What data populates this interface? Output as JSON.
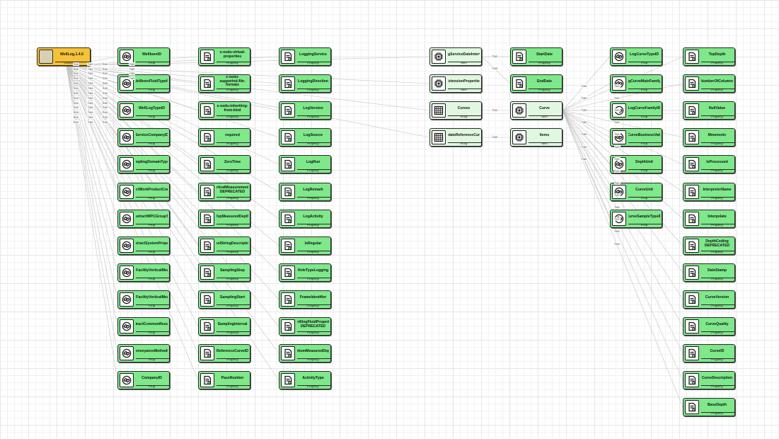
{
  "edge_label": "has",
  "root": {
    "id": "root",
    "title": "WellLog.1.4.0",
    "type": "OSDUType",
    "icon": "schema-box-icon"
  },
  "columns": [
    {
      "name": "abstract-and-id",
      "nodes": [
        {
          "id": "c1_0",
          "title": "WellboreID",
          "type": "Prop",
          "icon": "link-icon",
          "kind": "abstract"
        },
        {
          "id": "c1_1",
          "title": "WellboreFluidTypeID",
          "type": "Prop",
          "icon": "link-icon",
          "kind": "abstract"
        },
        {
          "id": "c1_2",
          "title": "WellLogTypeID",
          "type": "Prop",
          "icon": "link-icon",
          "kind": "abstract"
        },
        {
          "id": "c1_3",
          "title": "ServiceCompanyID",
          "type": "Prop",
          "icon": "link-icon",
          "kind": "abstract"
        },
        {
          "id": "c1_4",
          "title": "SamplingDomainTypeID",
          "type": "Prop",
          "icon": "link-icon",
          "kind": "abstract"
        },
        {
          "id": "c1_5",
          "title": "IsAbstractWorkProductComponent",
          "type": "Prop",
          "icon": "link-icon",
          "kind": "abstract"
        },
        {
          "id": "c1_6",
          "title": "IsAbstractWPCGroupType",
          "type": "Prop",
          "icon": "link-icon",
          "kind": "abstract"
        },
        {
          "id": "c1_7",
          "title": "IsAbstractSystemProperties",
          "type": "Prop",
          "icon": "link-icon",
          "kind": "abstract"
        },
        {
          "id": "c1_8",
          "title": "IsAbstractFacilityVerticalMeasurement",
          "type": "Prop",
          "icon": "link-icon",
          "kind": "abstract"
        },
        {
          "id": "c1_9",
          "title": "IsAbstractFacilityVerticalMeasurement",
          "type": "Prop",
          "icon": "link-icon",
          "kind": "abstract"
        },
        {
          "id": "c1_10",
          "title": "IsAbstractCommonResources",
          "type": "Prop",
          "icon": "link-icon",
          "kind": "abstract"
        },
        {
          "id": "c1_11",
          "title": "ConveyanceMethodID",
          "type": "Prop",
          "icon": "link-icon",
          "kind": "abstract"
        },
        {
          "id": "c1_12",
          "title": "CompanyID",
          "type": "Prop",
          "icon": "link-icon",
          "kind": "abstract"
        }
      ]
    },
    {
      "name": "properties-a",
      "nodes": [
        {
          "id": "c2_0",
          "title": "x-osdu-virtual-properties",
          "type": "Property",
          "icon": "document-icon",
          "kind": "property"
        },
        {
          "id": "c2_1",
          "title": "x-osdu-supported-file-formats",
          "type": "Property",
          "icon": "document-icon",
          "kind": "property"
        },
        {
          "id": "c2_2",
          "title": "x-osdu-inheriting-from-kind",
          "type": "Property",
          "icon": "document-icon",
          "kind": "property"
        },
        {
          "id": "c2_3",
          "title": "required",
          "type": "Property",
          "icon": "document-icon",
          "kind": "property"
        },
        {
          "id": "c2_4",
          "title": "ZeroTime",
          "type": "Property",
          "icon": "document-icon",
          "kind": "property"
        },
        {
          "id": "c2_5",
          "title": "VerticalMeasurementID DEPRECATED",
          "type": "Property",
          "icon": "document-icon",
          "kind": "property"
        },
        {
          "id": "c2_6",
          "title": "TopMeasuredDepth",
          "type": "Property",
          "icon": "document-icon",
          "kind": "property"
        },
        {
          "id": "c2_7",
          "title": "ToolStringDescription",
          "type": "Property",
          "icon": "document-icon",
          "kind": "property"
        },
        {
          "id": "c2_8",
          "title": "SamplingStop",
          "type": "Property",
          "icon": "document-icon",
          "kind": "property"
        },
        {
          "id": "c2_9",
          "title": "SamplingStart",
          "type": "Property",
          "icon": "document-icon",
          "kind": "property"
        },
        {
          "id": "c2_10",
          "title": "SamplingInterval",
          "type": "Property",
          "icon": "document-icon",
          "kind": "property"
        },
        {
          "id": "c2_11",
          "title": "ReferenceCurveID",
          "type": "Property",
          "icon": "document-icon",
          "kind": "property"
        },
        {
          "id": "c2_12",
          "title": "PassNumber",
          "type": "Property",
          "icon": "document-icon",
          "kind": "property"
        }
      ]
    },
    {
      "name": "properties-b",
      "nodes": [
        {
          "id": "c3_0",
          "title": "LoggingService",
          "type": "Property",
          "icon": "document-icon",
          "kind": "property"
        },
        {
          "id": "c3_1",
          "title": "LoggingDirection",
          "type": "Property",
          "icon": "document-icon",
          "kind": "property"
        },
        {
          "id": "c3_2",
          "title": "LogVersion",
          "type": "Property",
          "icon": "document-icon",
          "kind": "property"
        },
        {
          "id": "c3_3",
          "title": "LogSource",
          "type": "Property",
          "icon": "document-icon",
          "kind": "property"
        },
        {
          "id": "c3_4",
          "title": "LogRun",
          "type": "Property",
          "icon": "document-icon",
          "kind": "property"
        },
        {
          "id": "c3_5",
          "title": "LogRemark",
          "type": "Property",
          "icon": "document-icon",
          "kind": "property"
        },
        {
          "id": "c3_6",
          "title": "LogActivity",
          "type": "Property",
          "icon": "document-icon",
          "kind": "property"
        },
        {
          "id": "c3_7",
          "title": "IsRegular",
          "type": "Property",
          "icon": "document-icon",
          "kind": "property"
        },
        {
          "id": "c3_8",
          "title": "HoleTypeLogging",
          "type": "Property",
          "icon": "document-icon",
          "kind": "property"
        },
        {
          "id": "c3_9",
          "title": "FrameIdentifier",
          "type": "Property",
          "icon": "document-icon",
          "kind": "property"
        },
        {
          "id": "c3_10",
          "title": "DrillingFluidProperty DEPRECATED",
          "type": "Property",
          "icon": "document-icon",
          "kind": "property"
        },
        {
          "id": "c3_11",
          "title": "BottomMeasuredDepth",
          "type": "Property",
          "icon": "document-icon",
          "kind": "property"
        },
        {
          "id": "c3_12",
          "title": "ActivityType",
          "type": "Property",
          "icon": "document-icon",
          "kind": "property"
        }
      ]
    },
    {
      "name": "arrays-items",
      "nodes": [
        {
          "id": "c4_0",
          "title": "LogServiceDateInterval",
          "type": "Item",
          "icon": "chip-icon",
          "kind": "item"
        },
        {
          "id": "c4_1",
          "title": "ExtensionProperties",
          "type": "Item",
          "icon": "chip-icon",
          "kind": "item"
        },
        {
          "id": "c4_2",
          "title": "Curves",
          "type": "Array",
          "icon": "grid-icon",
          "kind": "array"
        },
        {
          "id": "c4_3",
          "title": "CandidateReferenceCurveIDs",
          "type": "Array",
          "icon": "grid-icon",
          "kind": "array"
        }
      ]
    },
    {
      "name": "interval-and-items",
      "nodes": [
        {
          "id": "c5_0",
          "title": "StartDate",
          "type": "Property",
          "icon": "document-icon",
          "kind": "property"
        },
        {
          "id": "c5_1",
          "title": "EndDate",
          "type": "Property",
          "icon": "document-icon",
          "kind": "property"
        },
        {
          "id": "c5_2",
          "title": "Curve",
          "type": "Item",
          "icon": "chip-icon",
          "kind": "item"
        },
        {
          "id": "c5_3",
          "title": "Items",
          "type": "Item",
          "icon": "chip-icon",
          "kind": "item"
        }
      ]
    },
    {
      "name": "curve-ids",
      "nodes": [
        {
          "id": "c6_0",
          "title": "LogCurveTypeID",
          "type": "Prop",
          "icon": "link-icon",
          "kind": "abstract"
        },
        {
          "id": "c6_1",
          "title": "LogCurveMainFamilyID",
          "type": "Prop",
          "icon": "link-icon",
          "kind": "abstract"
        },
        {
          "id": "c6_2",
          "title": "LogCurveFamilyID",
          "type": "Prop",
          "icon": "link-icon",
          "kind": "abstract"
        },
        {
          "id": "c6_3",
          "title": "LogCurveBusinessValueID",
          "type": "Prop",
          "icon": "link-icon",
          "kind": "abstract"
        },
        {
          "id": "c6_4",
          "title": "DepthUnit",
          "type": "Prop",
          "icon": "link-icon",
          "kind": "abstract"
        },
        {
          "id": "c6_5",
          "title": "CurveUnit",
          "type": "Prop",
          "icon": "link-icon",
          "kind": "abstract"
        },
        {
          "id": "c6_6",
          "title": "CurveSampleTypeID",
          "type": "Prop",
          "icon": "link-icon",
          "kind": "abstract"
        }
      ]
    },
    {
      "name": "curve-properties",
      "nodes": [
        {
          "id": "c7_0",
          "title": "TopDepth",
          "type": "Property",
          "icon": "document-icon",
          "kind": "property"
        },
        {
          "id": "c7_1",
          "title": "NumberOfColumns",
          "type": "Property",
          "icon": "document-icon",
          "kind": "property"
        },
        {
          "id": "c7_2",
          "title": "NullValue",
          "type": "Property",
          "icon": "document-icon",
          "kind": "property"
        },
        {
          "id": "c7_3",
          "title": "Mnemonic",
          "type": "Property",
          "icon": "document-icon",
          "kind": "property"
        },
        {
          "id": "c7_4",
          "title": "IsProcessed",
          "type": "Property",
          "icon": "document-icon",
          "kind": "property"
        },
        {
          "id": "c7_5",
          "title": "InterpreterName",
          "type": "Property",
          "icon": "document-icon",
          "kind": "property"
        },
        {
          "id": "c7_6",
          "title": "Interpolate",
          "type": "Property",
          "icon": "document-icon",
          "kind": "property"
        },
        {
          "id": "c7_7",
          "title": "DepthCoding DEPRECATED",
          "type": "Property",
          "icon": "document-icon",
          "kind": "property"
        },
        {
          "id": "c7_8",
          "title": "DateStamp",
          "type": "Property",
          "icon": "document-icon",
          "kind": "property"
        },
        {
          "id": "c7_9",
          "title": "CurveVersion",
          "type": "Property",
          "icon": "document-icon",
          "kind": "property"
        },
        {
          "id": "c7_10",
          "title": "CurveQuality",
          "type": "Property",
          "icon": "document-icon",
          "kind": "property"
        },
        {
          "id": "c7_11",
          "title": "CurveID",
          "type": "Property",
          "icon": "document-icon",
          "kind": "property"
        },
        {
          "id": "c7_12",
          "title": "CurveDescription",
          "type": "Property",
          "icon": "document-icon",
          "kind": "property"
        },
        {
          "id": "c7_13",
          "title": "BaseDepth",
          "type": "Property",
          "icon": "document-icon",
          "kind": "property"
        }
      ]
    }
  ],
  "edges": [
    [
      "root",
      "c1_0"
    ],
    [
      "root",
      "c1_1"
    ],
    [
      "root",
      "c1_2"
    ],
    [
      "root",
      "c1_3"
    ],
    [
      "root",
      "c1_4"
    ],
    [
      "root",
      "c1_5"
    ],
    [
      "root",
      "c1_6"
    ],
    [
      "root",
      "c1_7"
    ],
    [
      "root",
      "c1_8"
    ],
    [
      "root",
      "c1_9"
    ],
    [
      "root",
      "c1_10"
    ],
    [
      "root",
      "c1_11"
    ],
    [
      "root",
      "c1_12"
    ],
    [
      "root",
      "c2_0"
    ],
    [
      "root",
      "c2_1"
    ],
    [
      "root",
      "c2_2"
    ],
    [
      "root",
      "c2_3"
    ],
    [
      "root",
      "c2_4"
    ],
    [
      "root",
      "c2_5"
    ],
    [
      "root",
      "c2_6"
    ],
    [
      "root",
      "c2_7"
    ],
    [
      "root",
      "c2_8"
    ],
    [
      "root",
      "c2_9"
    ],
    [
      "root",
      "c2_10"
    ],
    [
      "root",
      "c2_11"
    ],
    [
      "root",
      "c2_12"
    ],
    [
      "root",
      "c3_0"
    ],
    [
      "root",
      "c3_1"
    ],
    [
      "root",
      "c3_2"
    ],
    [
      "root",
      "c3_3"
    ],
    [
      "root",
      "c3_4"
    ],
    [
      "root",
      "c3_5"
    ],
    [
      "root",
      "c3_6"
    ],
    [
      "root",
      "c3_7"
    ],
    [
      "root",
      "c3_8"
    ],
    [
      "root",
      "c3_9"
    ],
    [
      "root",
      "c3_10"
    ],
    [
      "root",
      "c3_11"
    ],
    [
      "root",
      "c3_12"
    ],
    [
      "root",
      "c4_0"
    ],
    [
      "root",
      "c4_1"
    ],
    [
      "root",
      "c4_2"
    ],
    [
      "root",
      "c4_3"
    ],
    [
      "c4_0",
      "c5_0"
    ],
    [
      "c4_0",
      "c5_1"
    ],
    [
      "c4_2",
      "c5_2"
    ],
    [
      "c4_3",
      "c5_3"
    ],
    [
      "c5_2",
      "c6_0"
    ],
    [
      "c5_2",
      "c6_1"
    ],
    [
      "c5_2",
      "c6_2"
    ],
    [
      "c5_2",
      "c6_3"
    ],
    [
      "c5_2",
      "c6_4"
    ],
    [
      "c5_2",
      "c6_5"
    ],
    [
      "c5_2",
      "c6_6"
    ],
    [
      "c5_2",
      "c7_0"
    ],
    [
      "c5_2",
      "c7_1"
    ],
    [
      "c5_2",
      "c7_2"
    ],
    [
      "c5_2",
      "c7_3"
    ],
    [
      "c5_2",
      "c7_4"
    ],
    [
      "c5_2",
      "c7_5"
    ],
    [
      "c5_2",
      "c7_6"
    ],
    [
      "c5_2",
      "c7_7"
    ],
    [
      "c5_2",
      "c7_8"
    ],
    [
      "c5_2",
      "c7_9"
    ],
    [
      "c5_2",
      "c7_10"
    ],
    [
      "c5_2",
      "c7_11"
    ],
    [
      "c5_2",
      "c7_12"
    ],
    [
      "c5_2",
      "c7_13"
    ]
  ],
  "colors": {
    "property_fill": "#7ee88a",
    "array_fill": "#dff8df",
    "root_fill": "#f5c23a",
    "edge": "#c4c4c4"
  }
}
